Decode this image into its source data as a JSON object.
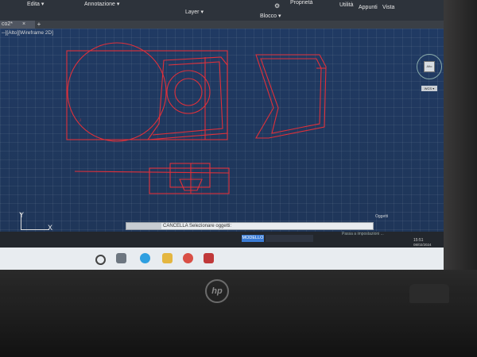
{
  "ribbon": {
    "items": [
      "Edita ▾",
      "Annotazione ▾",
      "Layer ▾",
      "Blocco ▾"
    ],
    "panels": [
      "Proprietà",
      "Utilità",
      "Appunti",
      "Vista"
    ]
  },
  "tab": {
    "title": "co2*",
    "close": "×",
    "add": "+"
  },
  "viewport": {
    "label": "─][Alto][Wireframe 2D]"
  },
  "viewcube": {
    "label": "Alto",
    "wcs": "WCS ▾"
  },
  "ucs": {
    "x": "X",
    "y": "Y"
  },
  "command": {
    "prompt": "CANCELLA Selezionare oggetti:",
    "history": "",
    "right_label": "Oggetti"
  },
  "statusbar": {
    "model_label": "MODELLO",
    "right_text": "Passa a impostazioni ...",
    "time": "15:51",
    "date": "08/02/2024"
  },
  "colors": {
    "drawing": "#e0303a",
    "grid_bg": "#203a63",
    "ribbon": "#2d333b",
    "model_button": "#3a7bd5"
  },
  "taskbar": {
    "icons": [
      "start-icon",
      "task-view-icon",
      "edge-icon",
      "file-explorer-icon",
      "chrome-icon",
      "autocad-icon"
    ]
  },
  "brand": {
    "logo": "hp"
  }
}
